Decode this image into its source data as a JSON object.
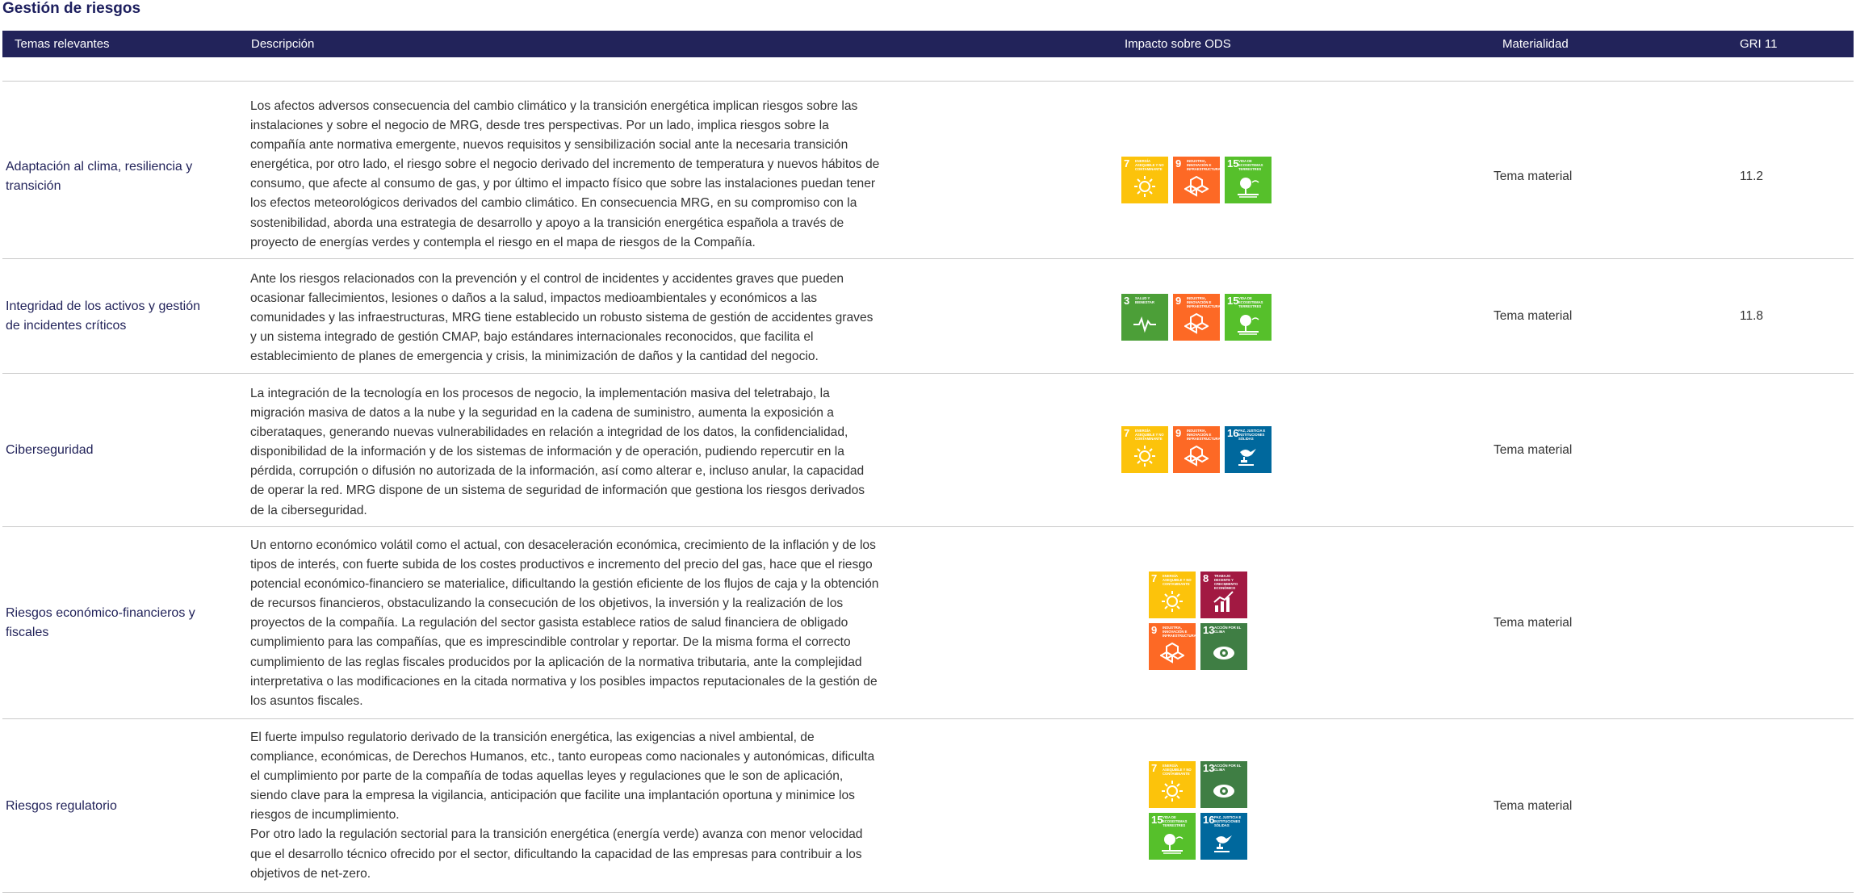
{
  "title": "Gestión de riesgos",
  "header": {
    "temas": "Temas relevantes",
    "descripcion": "Descripción",
    "impacto": "Impacto sobre ODS",
    "materialidad": "Materialidad",
    "gri": "GRI 11"
  },
  "sdg_labels": {
    "3": "Salud y bienestar",
    "7": "Energía asequible y no contaminante",
    "8": "Trabajo decente y crecimiento económico",
    "9": "Industria, innovación e infraestructura",
    "13": "Acción por el clima",
    "15": "Vida de ecosistemas terrestres",
    "16": "Paz, justicia e instituciones sólidas"
  },
  "sdg_colors": {
    "3": "#4c9f38",
    "7": "#fcc30b",
    "8": "#a21942",
    "9": "#fd6925",
    "13": "#3f7e44",
    "15": "#56c02b",
    "16": "#00689d"
  },
  "rows": [
    {
      "tema": "Adaptación al clima, resiliencia y transición",
      "descripcion": "Los afectos adversos consecuencia del cambio climático y la transición energética implican riesgos sobre las instalaciones y sobre el negocio de MRG, desde tres perspectivas. Por un lado, implica riesgos sobre la compañía ante normativa emergente, nuevos requisitos y sensibilización social ante la necesaria transición energética, por otro lado, el riesgo sobre el negocio derivado del incremento de temperatura y nuevos hábitos de consumo, que afecte al consumo de gas, y por último el impacto físico que sobre las instalaciones puedan tener los efectos meteorológicos derivados del cambio climático. En consecuencia MRG, en su compromiso con la sostenibilidad, aborda una estrategia de desarrollo y apoyo a la transición energética española a través de proyecto de energías verdes y contempla el riesgo en el mapa de riesgos de la Compañía.",
      "ods": [
        "7",
        "9",
        "15"
      ],
      "materialidad": "Tema material",
      "gri": "11.2"
    },
    {
      "tema": "Integridad de los activos y gestión de incidentes críticos",
      "descripcion": "Ante los riesgos relacionados con la prevención y el control de incidentes y accidentes graves que pueden ocasionar fallecimientos, lesiones o daños a la salud, impactos medioambientales y económicos a las comunidades y las infraestructuras, MRG tiene establecido un robusto sistema de gestión de accidentes graves y un sistema integrado de gestión CMAP, bajo estándares internacionales reconocidos, que facilita el establecimiento de planes de emergencia y crisis, la minimización de daños y la cantidad del negocio.",
      "ods": [
        "3",
        "9",
        "15"
      ],
      "materialidad": "Tema material",
      "gri": "11.8"
    },
    {
      "tema": "Ciberseguridad",
      "descripcion": "La integración de la tecnología en los procesos de negocio, la implementación masiva del teletrabajo, la migración masiva de datos a la nube y la seguridad en la cadena de suministro, aumenta la exposición a ciberataques, generando nuevas vulnerabilidades en relación a integridad de los datos, la confidencialidad, disponibilidad de la información y de los sistemas de información y de operación, pudiendo repercutir en la pérdida, corrupción o difusión no autorizada de la información, así como alterar e, incluso anular, la capacidad de operar la red. MRG dispone de un sistema de seguridad de información que gestiona los riesgos derivados de la ciberseguridad.",
      "ods": [
        "7",
        "9",
        "16"
      ],
      "materialidad": "Tema material",
      "gri": ""
    },
    {
      "tema": "Riesgos económico-financieros y fiscales",
      "descripcion": "Un entorno económico volátil como el actual, con desaceleración económica, crecimiento de la inflación y de los tipos de interés, con fuerte subida de los costes productivos e incremento del precio del gas, hace que el riesgo potencial económico-financiero se materialice, dificultando la gestión eficiente de los flujos de caja y la obtención de recursos financieros, obstaculizando la consecución de los objetivos, la inversión y la realización de los proyectos de la compañía. La regulación del sector gasista establece ratios de salud financiera de obligado cumplimiento para las compañías, que es imprescindible controlar y reportar. De la misma forma el correcto cumplimiento de las reglas fiscales producidos por la aplicación de la normativa tributaria, ante la complejidad interpretativa o las modificaciones en la citada normativa y los posibles impactos reputacionales de la gestión de los asuntos fiscales.",
      "ods": [
        "7",
        "8",
        "9",
        "13"
      ],
      "materialidad": "Tema material",
      "gri": ""
    },
    {
      "tema": "Riesgos regulatorio",
      "descripcion": "El fuerte impulso regulatorio derivado de la transición energética, las exigencias a nivel ambiental, de compliance, económicas, de Derechos Humanos, etc., tanto europeas como nacionales y autonómicas, dificulta el cumplimiento por parte de la compañía de todas aquellas leyes y regulaciones que le son de aplicación, siendo clave para la empresa la vigilancia, anticipación que facilite una implantación oportuna y minimice los riesgos de incumplimiento.\nPor otro lado la regulación sectorial para la transición energética (energía verde) avanza con menor velocidad que el desarrollo técnico ofrecido por el sector, dificultando la capacidad de las empresas para contribuir a los objetivos de net-zero.",
      "ods": [
        "7",
        "13",
        "15",
        "16"
      ],
      "materialidad": "Tema material",
      "gri": ""
    }
  ]
}
